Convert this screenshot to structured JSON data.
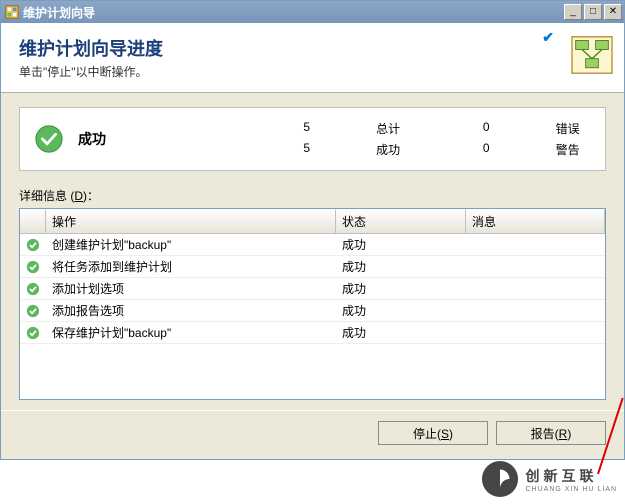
{
  "window": {
    "title": "维护计划向导"
  },
  "header": {
    "title": "维护计划向导进度",
    "subtitle": "单击\"停止\"以中断操作。"
  },
  "summary": {
    "status": "成功",
    "total_num": "5",
    "total_label": "总计",
    "success_num": "5",
    "success_label": "成功",
    "error_num": "0",
    "error_label": "错误",
    "warning_num": "0",
    "warning_label": "警告"
  },
  "details": {
    "label_pre": "详细信息 (",
    "label_key": "D",
    "label_post": ")：",
    "columns": {
      "action": "操作",
      "status": "状态",
      "message": "消息"
    },
    "rows": [
      {
        "action": "创建维护计划\"backup\"",
        "status": "成功",
        "message": ""
      },
      {
        "action": "将任务添加到维护计划",
        "status": "成功",
        "message": ""
      },
      {
        "action": "添加计划选项",
        "status": "成功",
        "message": ""
      },
      {
        "action": "添加报告选项",
        "status": "成功",
        "message": ""
      },
      {
        "action": "保存维护计划\"backup\"",
        "status": "成功",
        "message": ""
      }
    ]
  },
  "footer": {
    "stop_pre": "停止(",
    "stop_key": "S",
    "stop_post": ")",
    "report_pre": "报告(",
    "report_key": "R",
    "report_post": ")"
  },
  "watermark": {
    "cn": "创新互联",
    "en": "CHUANG XIN HU LIAN"
  }
}
